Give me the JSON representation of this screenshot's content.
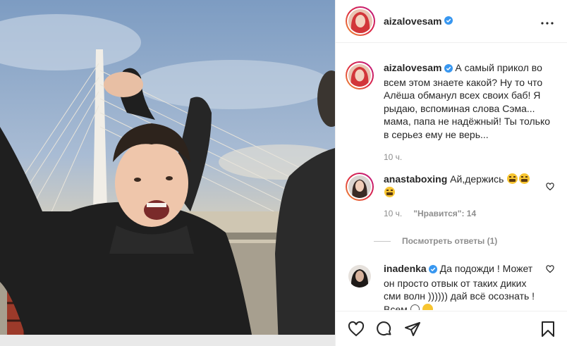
{
  "post": {
    "author": {
      "username": "aizalovesam",
      "verified": true
    },
    "caption": {
      "username": "aizalovesam",
      "text": "А самый прикол во всем этом знаете какой? Ну то что Алёша обманул всех своих баб! Я рыдаю, вспоминая слова Сэма... мама, папа не надёжный! Ты только в серьез ему не верь...",
      "time": "10 ч."
    },
    "comments": [
      {
        "username": "anastaboxing",
        "text": "Ай,держись",
        "time": "10 ч.",
        "likes_label": "\"Нравится\": 14",
        "view_replies": "Посмотреть ответы (1)"
      },
      {
        "username": "inadenka",
        "verified": true,
        "text": "Да подожди ! Может он просто отвык от таких диких сми волн )))))) дай всё осознать ! Всем"
      }
    ]
  },
  "icons": {
    "more": "more-horizontal-icon",
    "like": "heart-icon",
    "comment": "comment-bubble-icon",
    "share": "paper-plane-icon",
    "save": "bookmark-icon",
    "verified": "verified-badge-icon"
  },
  "colors": {
    "verified": "#3897f0",
    "muted": "#8e8e8e",
    "text": "#262626"
  }
}
